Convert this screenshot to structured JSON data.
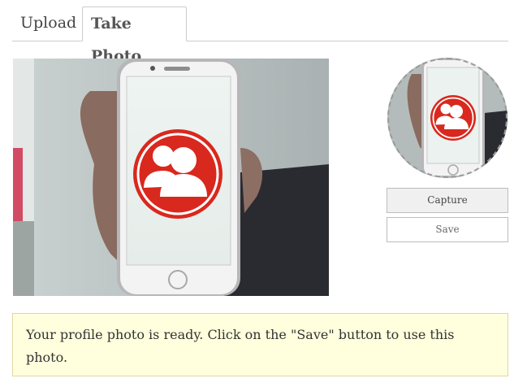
{
  "tabs": [
    {
      "label": "Upload",
      "active": false
    },
    {
      "label": "Take Photo",
      "active": true
    }
  ],
  "buttons": {
    "capture_label": "Capture",
    "save_label": "Save"
  },
  "notice": {
    "message": "Your profile photo is ready. Click on the \"Save\" button to use this photo."
  },
  "colors": {
    "notice_bg": "#ffffdd",
    "notice_border": "#e1d89f",
    "profile_red": "#d9281e"
  },
  "icons": {
    "profile_placeholder": "user-group-icon"
  }
}
